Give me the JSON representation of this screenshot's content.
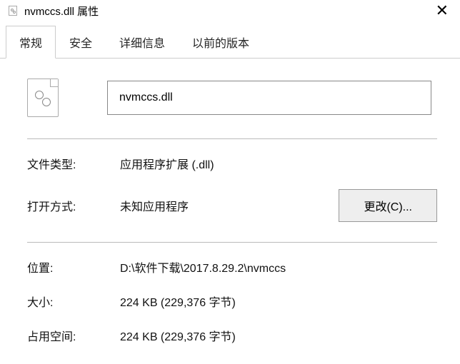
{
  "titlebar": {
    "title": "nvmccs.dll 属性"
  },
  "tabs": {
    "general": "常规",
    "security": "安全",
    "details": "详细信息",
    "previous": "以前的版本"
  },
  "file": {
    "name": "nvmccs.dll"
  },
  "fields": {
    "type_label": "文件类型:",
    "type_value": "应用程序扩展 (.dll)",
    "opens_label": "打开方式:",
    "opens_value": "未知应用程序",
    "change_button": "更改(C)...",
    "location_label": "位置:",
    "location_value": "D:\\软件下载\\2017.8.29.2\\nvmccs",
    "size_label": "大小:",
    "size_value": "224 KB (229,376 字节)",
    "size_on_disk_label": "占用空间:",
    "size_on_disk_value": "224 KB (229,376 字节)"
  }
}
